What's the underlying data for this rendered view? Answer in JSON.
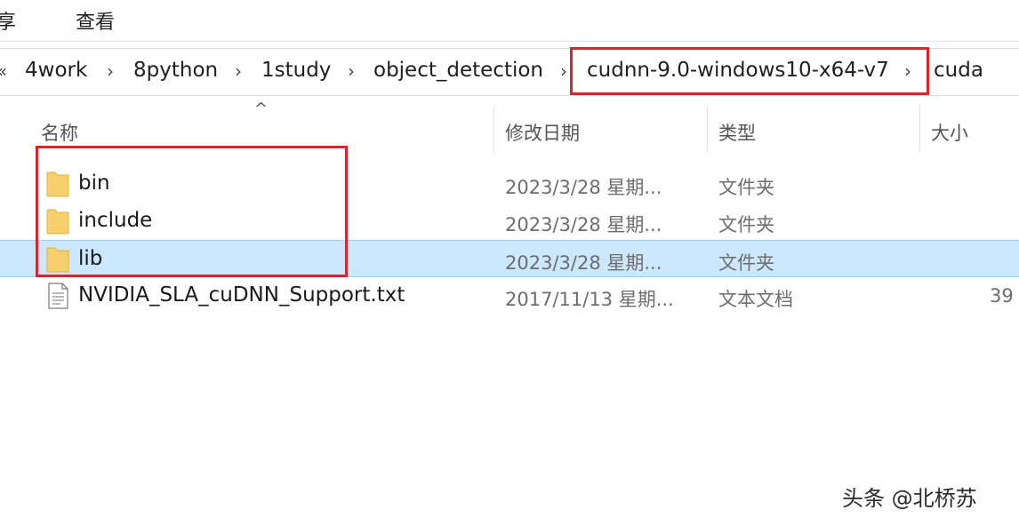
{
  "ribbon": {
    "tabs": [
      "享",
      "查看"
    ]
  },
  "address_bar": {
    "back_chevron": "«",
    "crumbs": [
      "4work",
      "8python",
      "1study",
      "object_detection",
      "cudnn-9.0-windows10-x64-v7",
      "cuda"
    ],
    "separator": "›"
  },
  "columns": {
    "name": "名称",
    "date_modified": "修改日期",
    "type": "类型",
    "size": "大小",
    "sort_indicator": "^"
  },
  "files": [
    {
      "name": "bin",
      "date": "2023/3/28 星期...",
      "type": "文件夹",
      "size": "",
      "icon": "folder-icon",
      "selected": false
    },
    {
      "name": "include",
      "date": "2023/3/28 星期...",
      "type": "文件夹",
      "size": "",
      "icon": "folder-icon",
      "selected": false
    },
    {
      "name": "lib",
      "date": "2023/3/28 星期...",
      "type": "文件夹",
      "size": "",
      "icon": "folder-icon",
      "selected": true
    },
    {
      "name": "NVIDIA_SLA_cuDNN_Support.txt",
      "date": "2017/11/13 星期...",
      "type": "文本文档",
      "size": "39",
      "icon": "text-file-icon",
      "selected": false
    }
  ],
  "colors": {
    "highlight_red": "#d9262e",
    "selection_bg": "#cce8ff",
    "folder_yellow": "#f7d06b"
  },
  "watermark": "头条 @北桥苏"
}
